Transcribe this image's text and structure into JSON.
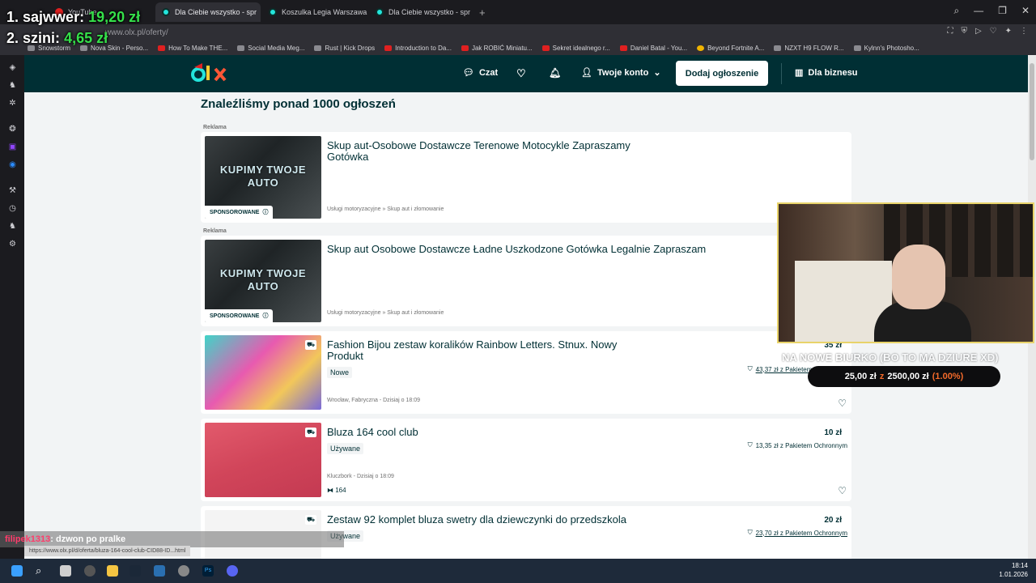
{
  "browser": {
    "tabs": [
      {
        "label": "YouTube",
        "icon": "youtube-icon",
        "active": false
      },
      {
        "label": "Dla Ciebie wszystko - spr",
        "icon": "olx-icon",
        "active": true
      },
      {
        "label": "Koszulka Legia Warszawa",
        "icon": "olx-icon",
        "active": false
      },
      {
        "label": "Dla Ciebie wszystko - spr",
        "icon": "olx-icon",
        "active": false
      }
    ],
    "new_tab_label": "+",
    "url": "www.olx.pl/oferty/",
    "bookmarks": [
      {
        "label": "Snowstorm",
        "icon": "gray"
      },
      {
        "label": "Nova Skin - Perso...",
        "icon": "gray"
      },
      {
        "label": "How To Make THE...",
        "icon": "youtube"
      },
      {
        "label": "Social Media Meg...",
        "icon": "gray"
      },
      {
        "label": "Rust | Kick Drops",
        "icon": "gray"
      },
      {
        "label": "Introduction to Da...",
        "icon": "youtube"
      },
      {
        "label": "Jak ROBIĆ Miniatu...",
        "icon": "youtube"
      },
      {
        "label": "Sekret idealnego r...",
        "icon": "youtube"
      },
      {
        "label": "Daniel Batal - You...",
        "icon": "youtube"
      },
      {
        "label": "Beyond Fortnite A...",
        "icon": "yellow"
      },
      {
        "label": "NZXT H9 FLOW R...",
        "icon": "gray"
      },
      {
        "label": "Kylnn's Photosho...",
        "icon": "gray"
      }
    ]
  },
  "olx": {
    "header": {
      "chat_label": "Czat",
      "account_label": "Twoje konto",
      "add_button": "Dodaj ogłoszenie",
      "business_label": "Dla biznesu"
    },
    "results_heading": "Znaleźliśmy ponad 1000 ogłoszeń",
    "ad_label": "Reklama",
    "sponsored_label": "SPONSOROWANE",
    "listings": [
      {
        "title": "Skup aut-Osobowe Dostawcze Terenowe Motocykle Zapraszamy Gotówka",
        "subtitle": "Usługi motoryzacyjne » Skup aut i złomowanie",
        "image_text": "KUPIMY TWOJE AUTO",
        "sponsored": true
      },
      {
        "title": "Skup aut Osobowe Dostawcze Ładne Uszkodzone Gotówka Legalnie Zapraszam",
        "subtitle": "Usługi motoryzacyjne » Skup aut i złomowanie",
        "image_text": "KUPIMY TWOJE AUTO",
        "sponsored": true
      },
      {
        "title": "Fashion Bijou zestaw koralików Rainbow Letters. Stnux. Nowy Produkt",
        "condition": "Nowe",
        "location": "Wrocław, Fabryczna - Dzisiaj o 18:09",
        "price": "35 zł",
        "protection": "43,37 zł z Pakietem Ochronnym"
      },
      {
        "title": "Bluza 164 cool club",
        "condition": "Używane",
        "location": "Kluczbork - Dzisiaj o 18:09",
        "price": "10 zł",
        "protection": "13,35 zł z Pakietem Ochronnym",
        "size": "164"
      },
      {
        "title": "Zestaw 92 komplet bluza swetry dla dziewczynki do przedszkola",
        "condition": "Używane",
        "price": "20 zł",
        "protection": "23,70 zł z Pakietem Ochronnym"
      }
    ]
  },
  "overlay": {
    "ranking": [
      {
        "rank": "1.",
        "name": "sajwwer:",
        "amount": "19,20 zł"
      },
      {
        "rank": "2.",
        "name": "szini:",
        "amount": "4,65 zł"
      }
    ],
    "donation_goal_text": "NA NOWE BIURKO (BO TO MA DZIURE XD)",
    "goal_current": "25,00 zł",
    "goal_separator": "z",
    "goal_target": "2500,00 zł",
    "goal_percent": "(1.00%)",
    "chat": {
      "user": "filipek1313",
      "message": ": dzwon po pralke"
    },
    "status_url": "https://www.olx.pl/d/oferta/bluza-164-cool-club-CID88-ID...html"
  },
  "taskbar": {
    "time": "18:14",
    "date": "1.01.2026"
  }
}
